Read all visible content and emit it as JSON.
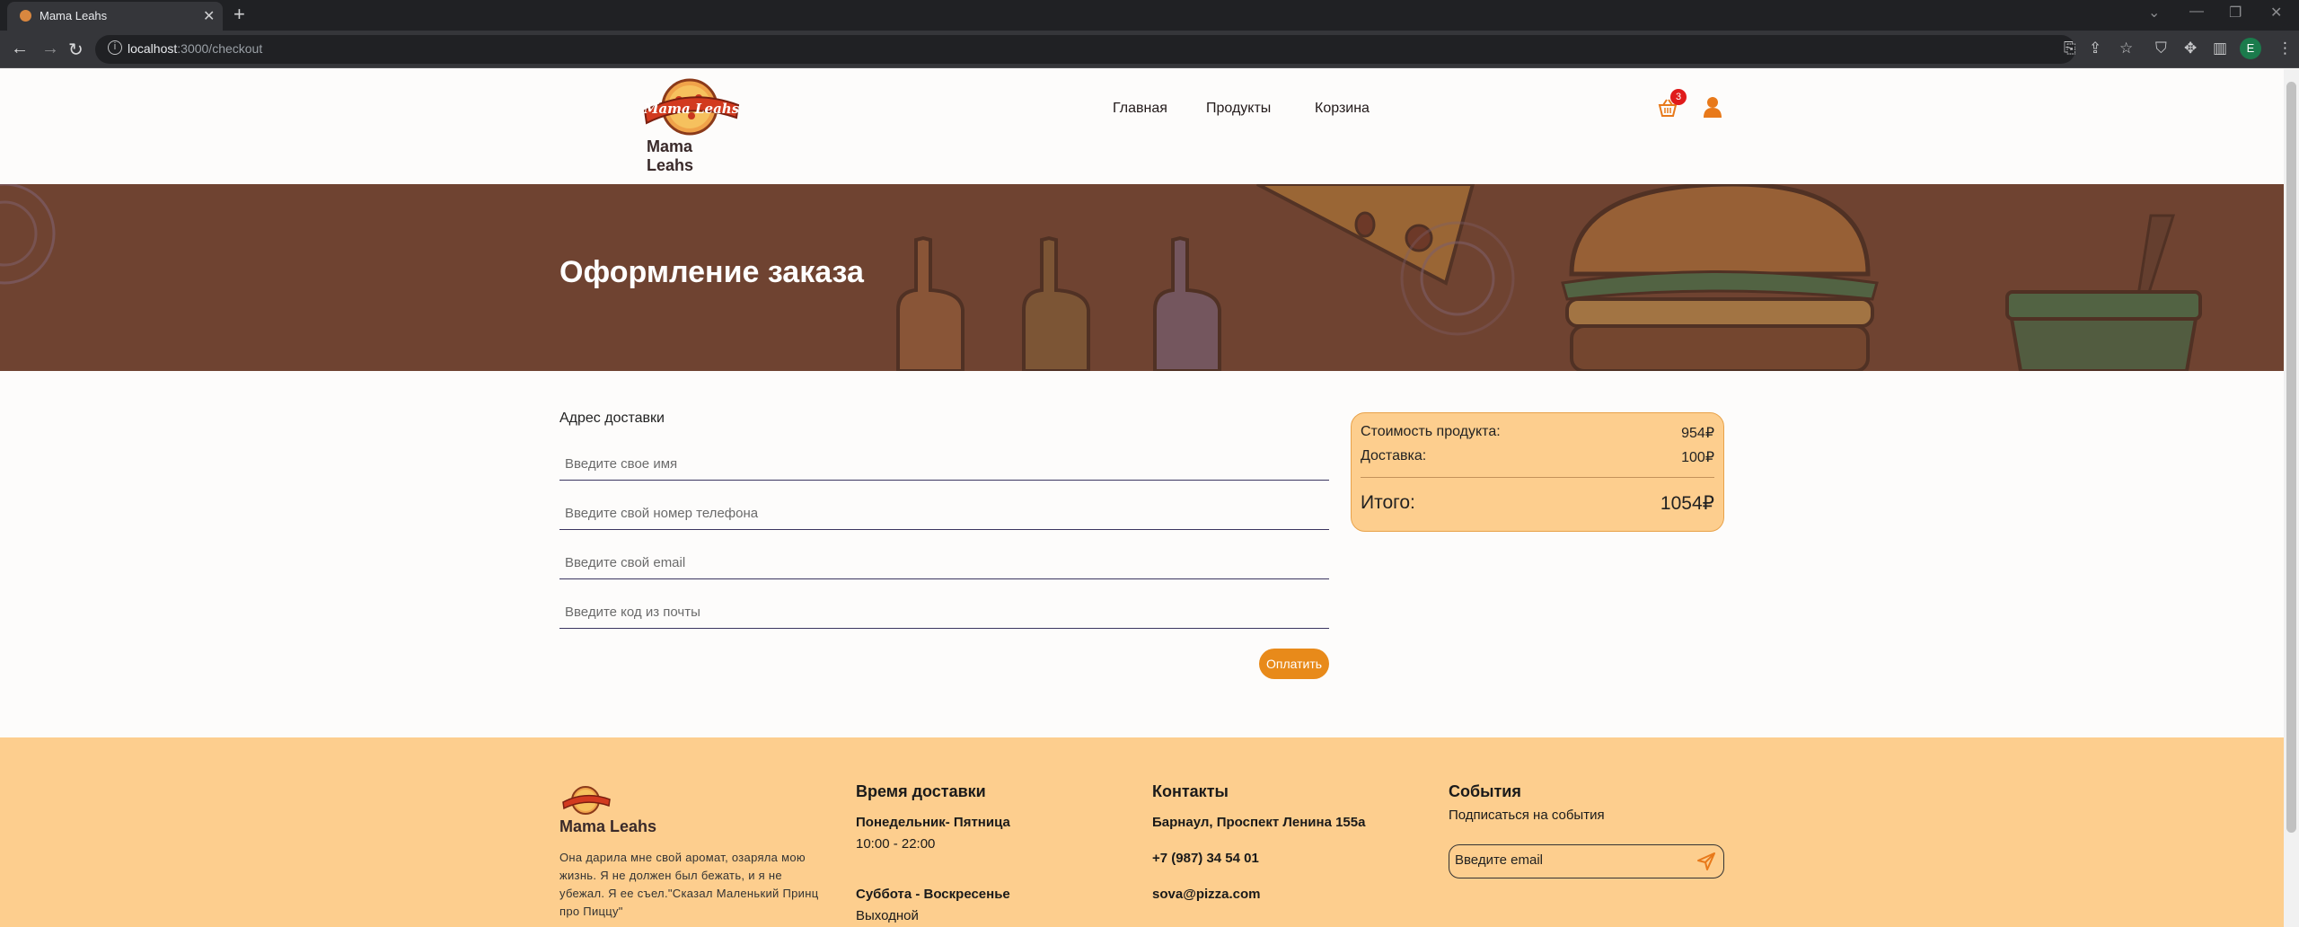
{
  "browser": {
    "tab_title": "Mama Leahs",
    "url_host": "localhost",
    "url_path": ":3000/checkout",
    "profile_initial": "E"
  },
  "header": {
    "logo_text": "Mama Leahs",
    "nav": [
      {
        "label": "Главная"
      },
      {
        "label": "Продукты"
      },
      {
        "label": "Корзина"
      }
    ],
    "cart_count": "3"
  },
  "hero": {
    "title": "Оформление заказа"
  },
  "form": {
    "section_title": "Адрес доставки",
    "fields": [
      {
        "placeholder": "Введите свое имя",
        "value": ""
      },
      {
        "placeholder": "Введите свой номер телефона",
        "value": ""
      },
      {
        "placeholder": "Введите свой email",
        "value": ""
      },
      {
        "placeholder": "Введите код из почты",
        "value": ""
      }
    ],
    "pay_label": "Оплатить"
  },
  "summary": {
    "product_cost_label": "Стоимость продукта:",
    "product_cost_value": "954₽",
    "delivery_label": "Доставка:",
    "delivery_value": "100₽",
    "total_label": "Итого:",
    "total_value": "1054₽"
  },
  "footer": {
    "brand": "Mama Leahs",
    "quote": "Она дарила мне свой аромат, озаряла мою жизнь. Я не должен был бежать, и я не убежал. Я ее съел.\"Сказал Маленький Принц про Пиццу\"",
    "delivery_title": "Время доставки",
    "weekday_label": "Понедельник- Пятница",
    "weekday_hours": "10:00 - 22:00",
    "weekend_label": "Суббота - Воскресенье",
    "weekend_hours": "Выходной",
    "contacts_title": "Контакты",
    "address": "Барнаул, Проспект Ленина 155а",
    "phone": "+7 (987) 34 54 01",
    "email": "sova@pizza.com",
    "events_title": "События",
    "events_subtitle": "Подписаться на события",
    "subscribe_placeholder": "Введите email"
  },
  "colors": {
    "accent": "#e88a1a",
    "hero_bg": "#704432",
    "footer_bg": "#fdce8e",
    "badge": "#e01b1b"
  }
}
